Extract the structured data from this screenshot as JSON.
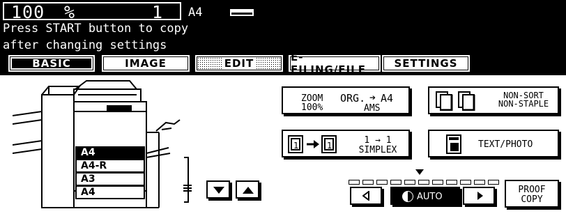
{
  "status": {
    "zoom": "100",
    "zoom_unit": "%",
    "copies": "1",
    "paper": "A4",
    "message_line1": "Press START button to copy",
    "message_line2": "after changing settings"
  },
  "tabs": [
    {
      "label": "BASIC",
      "active": true
    },
    {
      "label": "IMAGE",
      "active": false
    },
    {
      "label": "EDIT",
      "active": false
    },
    {
      "label": "E-FILING/FILE",
      "active": false
    },
    {
      "label": "SETTINGS",
      "active": false
    }
  ],
  "paper_sizes": [
    "A4",
    "A4-R",
    "A3",
    "A4"
  ],
  "selected_paper_index": 0,
  "buttons": {
    "zoom": {
      "label": "ZOOM",
      "value": "100%",
      "orig": "ORG.",
      "orig_target": "A4",
      "mode": "AMS"
    },
    "sort": {
      "line1": "NON-SORT",
      "line2": "NON-STAPLE"
    },
    "duplex": {
      "line1": "1 → 1",
      "line2": "SIMPLEX"
    },
    "image_mode": {
      "label": "TEXT/PHOTO"
    },
    "density_auto": {
      "label": "AUTO"
    },
    "proof": {
      "line1": "PROOF",
      "line2": "COPY"
    }
  },
  "density_level": {
    "segments": 11,
    "current": 5
  },
  "icons": [
    "paper-tray-icon",
    "arrow-down-icon",
    "arrow-up-icon",
    "lighter-icon",
    "darker-icon",
    "auto-density-icon"
  ],
  "colors": {
    "background": "#000000",
    "foreground": "#ffffff"
  }
}
